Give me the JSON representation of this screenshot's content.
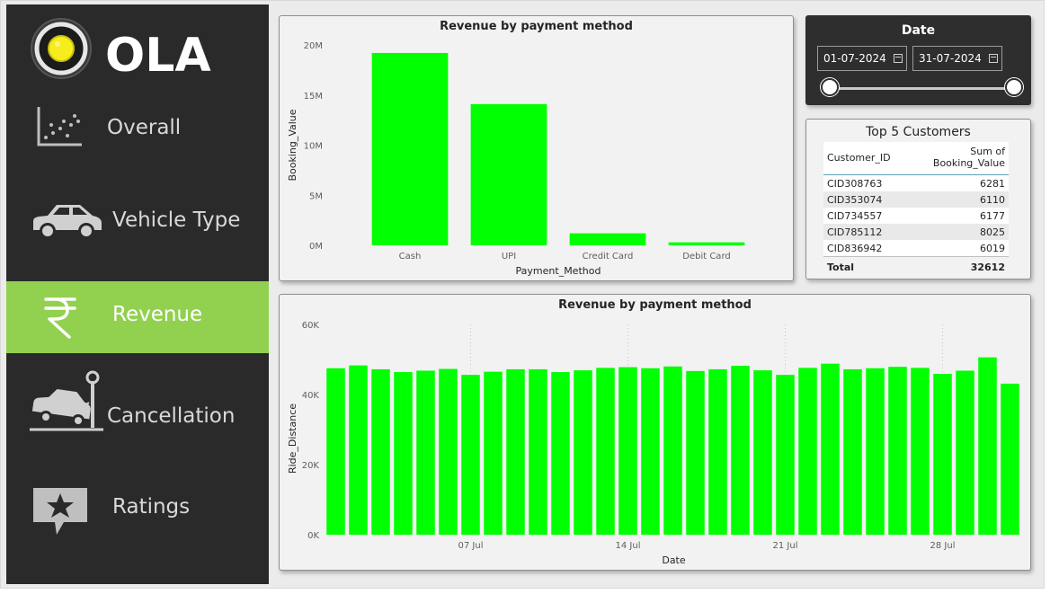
{
  "brand": {
    "name": "OLA",
    "logo_color": "#f7ec1c"
  },
  "sidebar": {
    "items": [
      {
        "label": "Overall",
        "icon": "scatter-chart-icon"
      },
      {
        "label": "Vehicle Type",
        "icon": "car-icon"
      },
      {
        "label": "Revenue",
        "icon": "rupee-icon",
        "active": true
      },
      {
        "label": "Cancellation",
        "icon": "car-crash-icon"
      },
      {
        "label": "Ratings",
        "icon": "star-review-icon"
      }
    ],
    "active_color": "#92d050"
  },
  "date_filter": {
    "title": "Date",
    "start": "01-07-2024",
    "end": "31-07-2024"
  },
  "top_customers": {
    "title": "Top 5 Customers",
    "columns": [
      "Customer_ID",
      "Sum of Booking_Value"
    ],
    "rows": [
      [
        "CID308763",
        "6281"
      ],
      [
        "CID353074",
        "6110"
      ],
      [
        "CID734557",
        "6177"
      ],
      [
        "CID785112",
        "8025"
      ],
      [
        "CID836942",
        "6019"
      ]
    ],
    "total_label": "Total",
    "total_value": "32612"
  },
  "chart_data": [
    {
      "type": "bar",
      "title": "Revenue by payment method",
      "xlabel": "Payment_Method",
      "ylabel": "Booking_Value",
      "categories": [
        "Cash",
        "UPI",
        "Credit Card",
        "Debit Card"
      ],
      "values": [
        19200000,
        14100000,
        1200000,
        300000
      ],
      "ylim": [
        0,
        20000000
      ],
      "yticks": [
        0,
        5000000,
        10000000,
        15000000,
        20000000
      ],
      "ytick_labels": [
        "0M",
        "5M",
        "10M",
        "15M",
        "20M"
      ],
      "color": "#00ff00",
      "grid": false
    },
    {
      "type": "bar",
      "title": "Revenue by payment method",
      "xlabel": "Date",
      "ylabel": "Ride_Distance",
      "x": [
        "2024-07-01",
        "2024-07-02",
        "2024-07-03",
        "2024-07-04",
        "2024-07-05",
        "2024-07-06",
        "2024-07-07",
        "2024-07-08",
        "2024-07-09",
        "2024-07-10",
        "2024-07-11",
        "2024-07-12",
        "2024-07-13",
        "2024-07-14",
        "2024-07-15",
        "2024-07-16",
        "2024-07-17",
        "2024-07-18",
        "2024-07-19",
        "2024-07-20",
        "2024-07-21",
        "2024-07-22",
        "2024-07-23",
        "2024-07-24",
        "2024-07-25",
        "2024-07-26",
        "2024-07-27",
        "2024-07-28",
        "2024-07-29",
        "2024-07-30",
        "2024-07-31"
      ],
      "values": [
        47500,
        48300,
        47200,
        46400,
        46800,
        47300,
        45600,
        46500,
        47200,
        47200,
        46400,
        46900,
        47600,
        47800,
        47500,
        48000,
        46700,
        47200,
        48200,
        46900,
        45600,
        47600,
        48800,
        47200,
        47500,
        47900,
        47600,
        45900,
        46800,
        50600,
        43100
      ],
      "ylim": [
        0,
        60000
      ],
      "yticks": [
        0,
        20000,
        40000,
        60000
      ],
      "ytick_labels": [
        "0K",
        "20K",
        "40K",
        "60K"
      ],
      "xtick_labels": [
        {
          "label": "07 Jul",
          "at": "2024-07-07"
        },
        {
          "label": "14 Jul",
          "at": "2024-07-14"
        },
        {
          "label": "21 Jul",
          "at": "2024-07-21"
        },
        {
          "label": "28 Jul",
          "at": "2024-07-28"
        }
      ],
      "color": "#00ff00",
      "grid": true
    }
  ]
}
